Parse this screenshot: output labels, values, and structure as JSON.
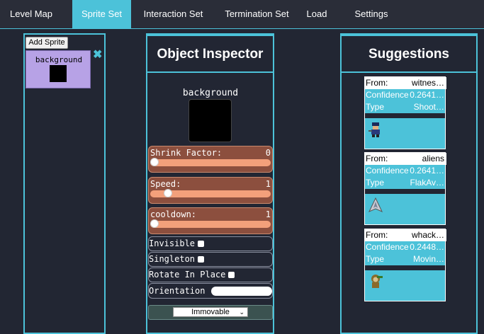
{
  "tabs": [
    {
      "label": "Level Map",
      "active": false
    },
    {
      "label": "Sprite Set",
      "active": true
    },
    {
      "label": "Interaction Set",
      "active": false
    },
    {
      "label": "Termination Set",
      "active": false
    },
    {
      "label": "Load",
      "active": false
    },
    {
      "label": "Settings",
      "active": false
    }
  ],
  "sprite_panel": {
    "add_button": "Add Sprite",
    "sprites": [
      {
        "name": "background"
      }
    ],
    "close_icon": "close-icon"
  },
  "inspector": {
    "title": "Object Inspector",
    "sprite_name": "background",
    "sliders": [
      {
        "label": "Shrink Factor:",
        "value": "0",
        "fraction": 0.0
      },
      {
        "label": "Speed:",
        "value": "1",
        "fraction": 0.12
      },
      {
        "label": "cooldown:",
        "value": "1",
        "fraction": 0.0
      }
    ],
    "checkboxes": [
      {
        "label": "Invisible"
      },
      {
        "label": "Singleton"
      },
      {
        "label": "Rotate In Place"
      }
    ],
    "orientation_label": "Orientation",
    "type_select": "Immovable"
  },
  "suggestions": {
    "title": "Suggestions",
    "items": [
      {
        "from_label": "From:",
        "from": "witnes…",
        "confidence_label": "Confidence",
        "confidence": "0.2641…",
        "type_label": "Type",
        "type": "Shoot…",
        "icon": "soldier-icon"
      },
      {
        "from_label": "From:",
        "from": "aliens",
        "confidence_label": "Confidence",
        "confidence": "0.2641…",
        "type_label": "Type",
        "type": "FlakAv…",
        "icon": "spaceship-icon"
      },
      {
        "from_label": "From:",
        "from": "whack…",
        "confidence_label": "Confidence",
        "confidence": "0.2448…",
        "type_label": "Type",
        "type": "Movin…",
        "icon": "monkey-icon"
      }
    ]
  },
  "colors": {
    "accent": "#4cc2d9",
    "background": "#222633",
    "sprite_card": "#b7a2e6",
    "slider_panel": "#8c4f3e",
    "slider_track": "#f3a07b"
  }
}
